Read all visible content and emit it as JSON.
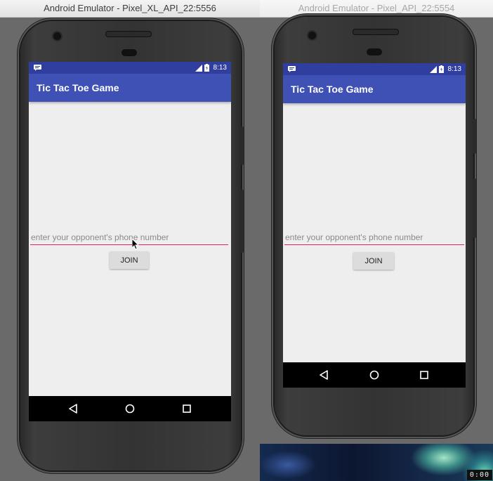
{
  "windows": [
    {
      "title": "Android Emulator - Pixel_XL_API_22:5556",
      "status_time": "8:13",
      "app_title": "Tic Tac Toe Game",
      "phone_input_placeholder": "enter your opponent's phone number",
      "join_label": "JOIN",
      "nav": {
        "back": "back-icon",
        "home": "home-icon",
        "recents": "recents-icon"
      }
    },
    {
      "title": "Android Emulator - Pixel_API_22:5554",
      "status_time": "8:13",
      "app_title": "Tic Tac Toe Game",
      "phone_input_placeholder": "enter your opponent's phone number",
      "join_label": "JOIN",
      "nav": {
        "back": "back-icon",
        "home": "home-icon",
        "recents": "recents-icon"
      }
    }
  ],
  "recording_timer": "0:00",
  "colors": {
    "status_bar": "#303f9f",
    "app_bar": "#3f51b5",
    "input_underline": "#e91e63",
    "screen_bg": "#eeeeee"
  }
}
